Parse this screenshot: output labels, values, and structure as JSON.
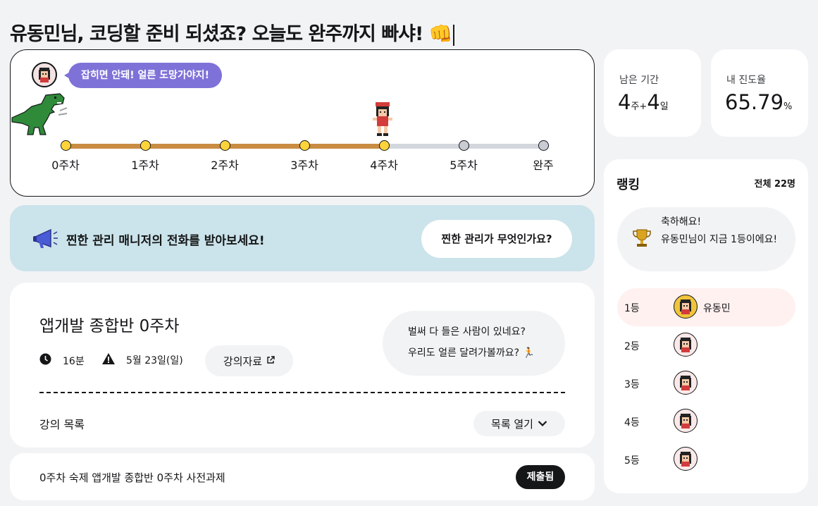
{
  "header": {
    "greeting": "유동민님, 코딩할 준비 되셨죠? 오늘도 완주까지 빠샤! 👊"
  },
  "progress": {
    "speech": "잡히면 안돼! 얼른 도망가야지!",
    "weeks": [
      "0주차",
      "1주차",
      "2주차",
      "3주차",
      "4주차",
      "5주차",
      "완주"
    ],
    "completed_nodes": 5,
    "fill_fraction": 0.667
  },
  "banner": {
    "text": "찐한 관리 매니저의 전화를 받아보세요!",
    "button": "찐한 관리가 무엇인가요?"
  },
  "course": {
    "title": "앱개발 종합반 0주차",
    "duration": "16분",
    "deadline": "5월 23일(일)",
    "material_button": "강의자료",
    "cheer_line1": "벌써 다 들은 사람이 있네요?",
    "cheer_line2": "우리도 얼른 달려가볼까요? 🏃",
    "list_title": "강의 목록",
    "list_toggle": "목록 열기"
  },
  "homework": {
    "text": "0주차 숙제 앱개발 종합반 0주차 사전과제",
    "badge": "제출됨"
  },
  "stats": {
    "remaining_label": "남은 기간",
    "weeks_value": "4",
    "weeks_unit": "주",
    "plus": "+",
    "days_value": "4",
    "days_unit": "일",
    "progress_label": "내 진도율",
    "progress_value": "65.79",
    "progress_unit": "%"
  },
  "ranking": {
    "title": "랭킹",
    "total": "전체 22명",
    "congrats_line1": "축하해요!",
    "congrats_line2": "유동민님이 지금 1등이에요!",
    "rows": [
      {
        "rank": "1등",
        "name": "유동민"
      },
      {
        "rank": "2등",
        "name": ""
      },
      {
        "rank": "3등",
        "name": ""
      },
      {
        "rank": "4등",
        "name": ""
      },
      {
        "rank": "5등",
        "name": ""
      }
    ]
  },
  "colors": {
    "accent_purple": "#7e72d8",
    "track_fill": "#c98c43",
    "banner_bg": "#cbe3ea",
    "node_done": "#ffd43b"
  },
  "icons": [
    "character-avatar-icon",
    "dinosaur-icon",
    "runner-character-icon",
    "megaphone-icon",
    "clock-icon",
    "warning-icon",
    "external-link-icon",
    "chevron-down-icon",
    "trophy-icon"
  ]
}
